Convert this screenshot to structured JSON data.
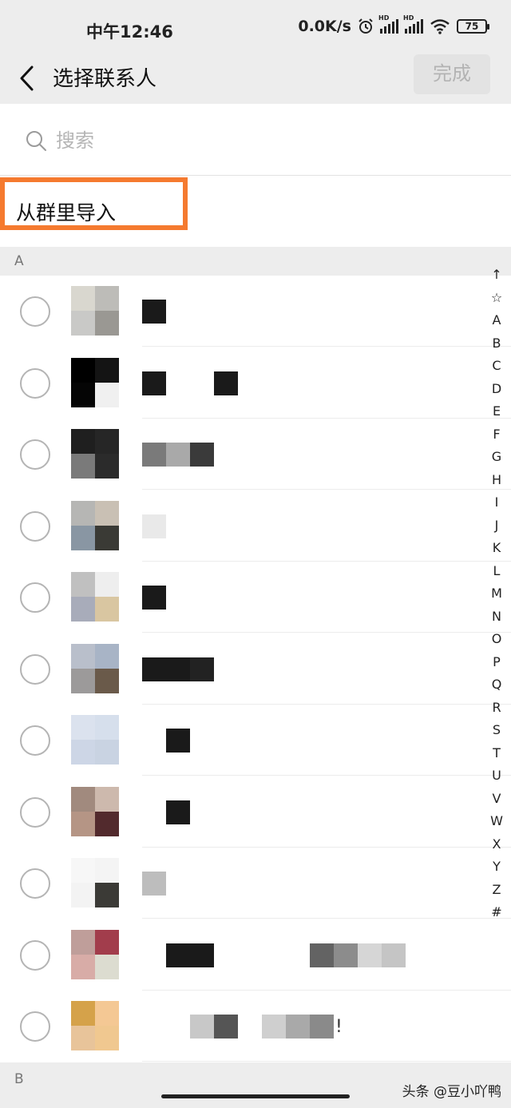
{
  "status_bar": {
    "time": "中午12:46",
    "network_speed": "0.0K/s",
    "signal_badge": "HD",
    "battery": "75"
  },
  "nav": {
    "title": "选择联系人",
    "done_label": "完成"
  },
  "search": {
    "placeholder": "搜索"
  },
  "import_from_group": {
    "label": "从群里导入",
    "highlight_color": "#f57a2f"
  },
  "sections": [
    {
      "letter": "A"
    },
    {
      "letter": "B"
    }
  ],
  "contacts": [
    {
      "name_suffix": "",
      "avatar_colors": [
        "#d9d7cf",
        "#bdbcb8",
        "#c9c9c7",
        "#9a9893"
      ],
      "name_blocks": [
        "#1a1a1a"
      ]
    },
    {
      "name_suffix": "",
      "avatar_colors": [
        "#000000",
        "#141414",
        "#050505",
        "#f0f0f0"
      ],
      "name_blocks": [
        "#1a1a1a",
        "",
        "",
        "#1a1a1a"
      ]
    },
    {
      "name_suffix": "",
      "avatar_colors": [
        "#1f1f1f",
        "#262626",
        "#7a7a7a",
        "#2b2b2b"
      ],
      "name_blocks": [
        "#7a7a7a",
        "#a9a9a9",
        "#3a3a3a"
      ]
    },
    {
      "name_suffix": "",
      "avatar_colors": [
        "#b6b6b4",
        "#c9c0b4",
        "#8996a3",
        "#3a3a35"
      ],
      "name_blocks": [
        "#e9e9e9"
      ]
    },
    {
      "name_suffix": "",
      "avatar_colors": [
        "#c0c0c0",
        "#eeeeee",
        "#a8acba",
        "#d9c6a1"
      ],
      "name_blocks": [
        "#1a1a1a"
      ]
    },
    {
      "name_suffix": "",
      "avatar_colors": [
        "#b9bfcb",
        "#a8b4c6",
        "#9c9a9a",
        "#6a5a4a"
      ],
      "name_blocks": [
        "#1a1a1a",
        "#1a1a1a",
        "#222222"
      ]
    },
    {
      "name_suffix": "",
      "avatar_colors": [
        "#dbe2ee",
        "#d6dfec",
        "#cdd6e6",
        "#c9d3e2"
      ],
      "name_blocks": [
        "",
        "#1a1a1a"
      ]
    },
    {
      "name_suffix": "",
      "avatar_colors": [
        "#a18a7e",
        "#cdb9ad",
        "#b59585",
        "#522a2d"
      ],
      "name_blocks": [
        "",
        "#1a1a1a"
      ]
    },
    {
      "name_suffix": "",
      "avatar_colors": [
        "#f7f7f7",
        "#f4f4f4",
        "#f3f3f3",
        "#3b3a36"
      ],
      "name_blocks": [
        "#bdbdbd"
      ]
    },
    {
      "name_suffix": "",
      "avatar_colors": [
        "#bf9e9a",
        "#a23d4c",
        "#d8aca7",
        "#dcdcd0"
      ],
      "name_blocks": [
        "",
        "#1a1a1a",
        "#1a1a1a",
        "",
        "",
        "",
        "",
        "#636363",
        "#8c8c8c",
        "#d6d6d6",
        "#c5c5c5"
      ]
    },
    {
      "name_suffix": "!",
      "avatar_colors": [
        "#d5a24a",
        "#f4c894",
        "#e8c49a",
        "#f0c890"
      ],
      "name_blocks": [
        "",
        "",
        "#c8c8c8",
        "#555555",
        "",
        "#cfcfcf",
        "#a9a9a9",
        "#8a8a8a"
      ]
    }
  ],
  "index_letters": [
    "↑",
    "☆",
    "A",
    "B",
    "C",
    "D",
    "E",
    "F",
    "G",
    "H",
    "I",
    "J",
    "K",
    "L",
    "M",
    "N",
    "O",
    "P",
    "Q",
    "R",
    "S",
    "T",
    "U",
    "V",
    "W",
    "X",
    "Y",
    "Z",
    "#"
  ],
  "watermark": "头条 @豆小吖鸭"
}
